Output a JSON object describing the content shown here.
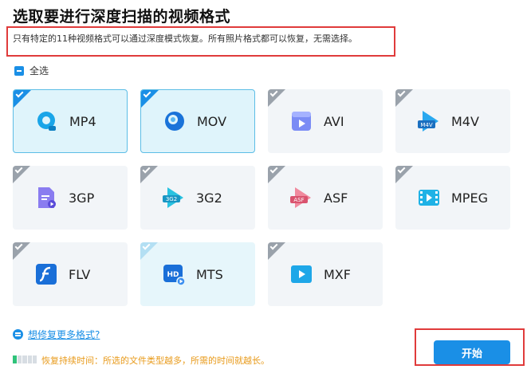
{
  "title": "选取要进行深度扫描的视频格式",
  "note": "只有特定的11种视频格式可以通过深度模式恢复。所有照片格式都可以恢复，无需选择。",
  "select_all": {
    "label": "全选",
    "checked": "partial"
  },
  "formats": [
    {
      "label": "MP4",
      "selected": true,
      "icon": "mp4-icon"
    },
    {
      "label": "MOV",
      "selected": true,
      "icon": "mov-icon"
    },
    {
      "label": "AVI",
      "selected": false,
      "icon": "avi-icon"
    },
    {
      "label": "M4V",
      "selected": false,
      "icon": "m4v-icon",
      "badge": "M4V"
    },
    {
      "label": "3GP",
      "selected": false,
      "icon": "3gp-icon"
    },
    {
      "label": "3G2",
      "selected": false,
      "icon": "3g2-icon",
      "badge": "3G2"
    },
    {
      "label": "ASF",
      "selected": false,
      "icon": "asf-icon",
      "badge": "ASF"
    },
    {
      "label": "MPEG",
      "selected": false,
      "icon": "mpeg-icon"
    },
    {
      "label": "FLV",
      "selected": false,
      "icon": "flv-icon"
    },
    {
      "label": "MTS",
      "selected": false,
      "icon": "mts-icon",
      "badge": "HD"
    },
    {
      "label": "MXF",
      "selected": false,
      "icon": "mxf-icon"
    }
  ],
  "more_formats_link": "想修复更多格式?",
  "duration_note": "恢复持续时间：所选的文件类型越多，所需的时间就越长。",
  "progress_fraction": 0.2,
  "start_button": "开始",
  "colors": {
    "accent": "#1a8fe6",
    "highlight_border": "#e03b3b",
    "warning_text": "#e89a1a",
    "progress_fill": "#2fc37a"
  }
}
